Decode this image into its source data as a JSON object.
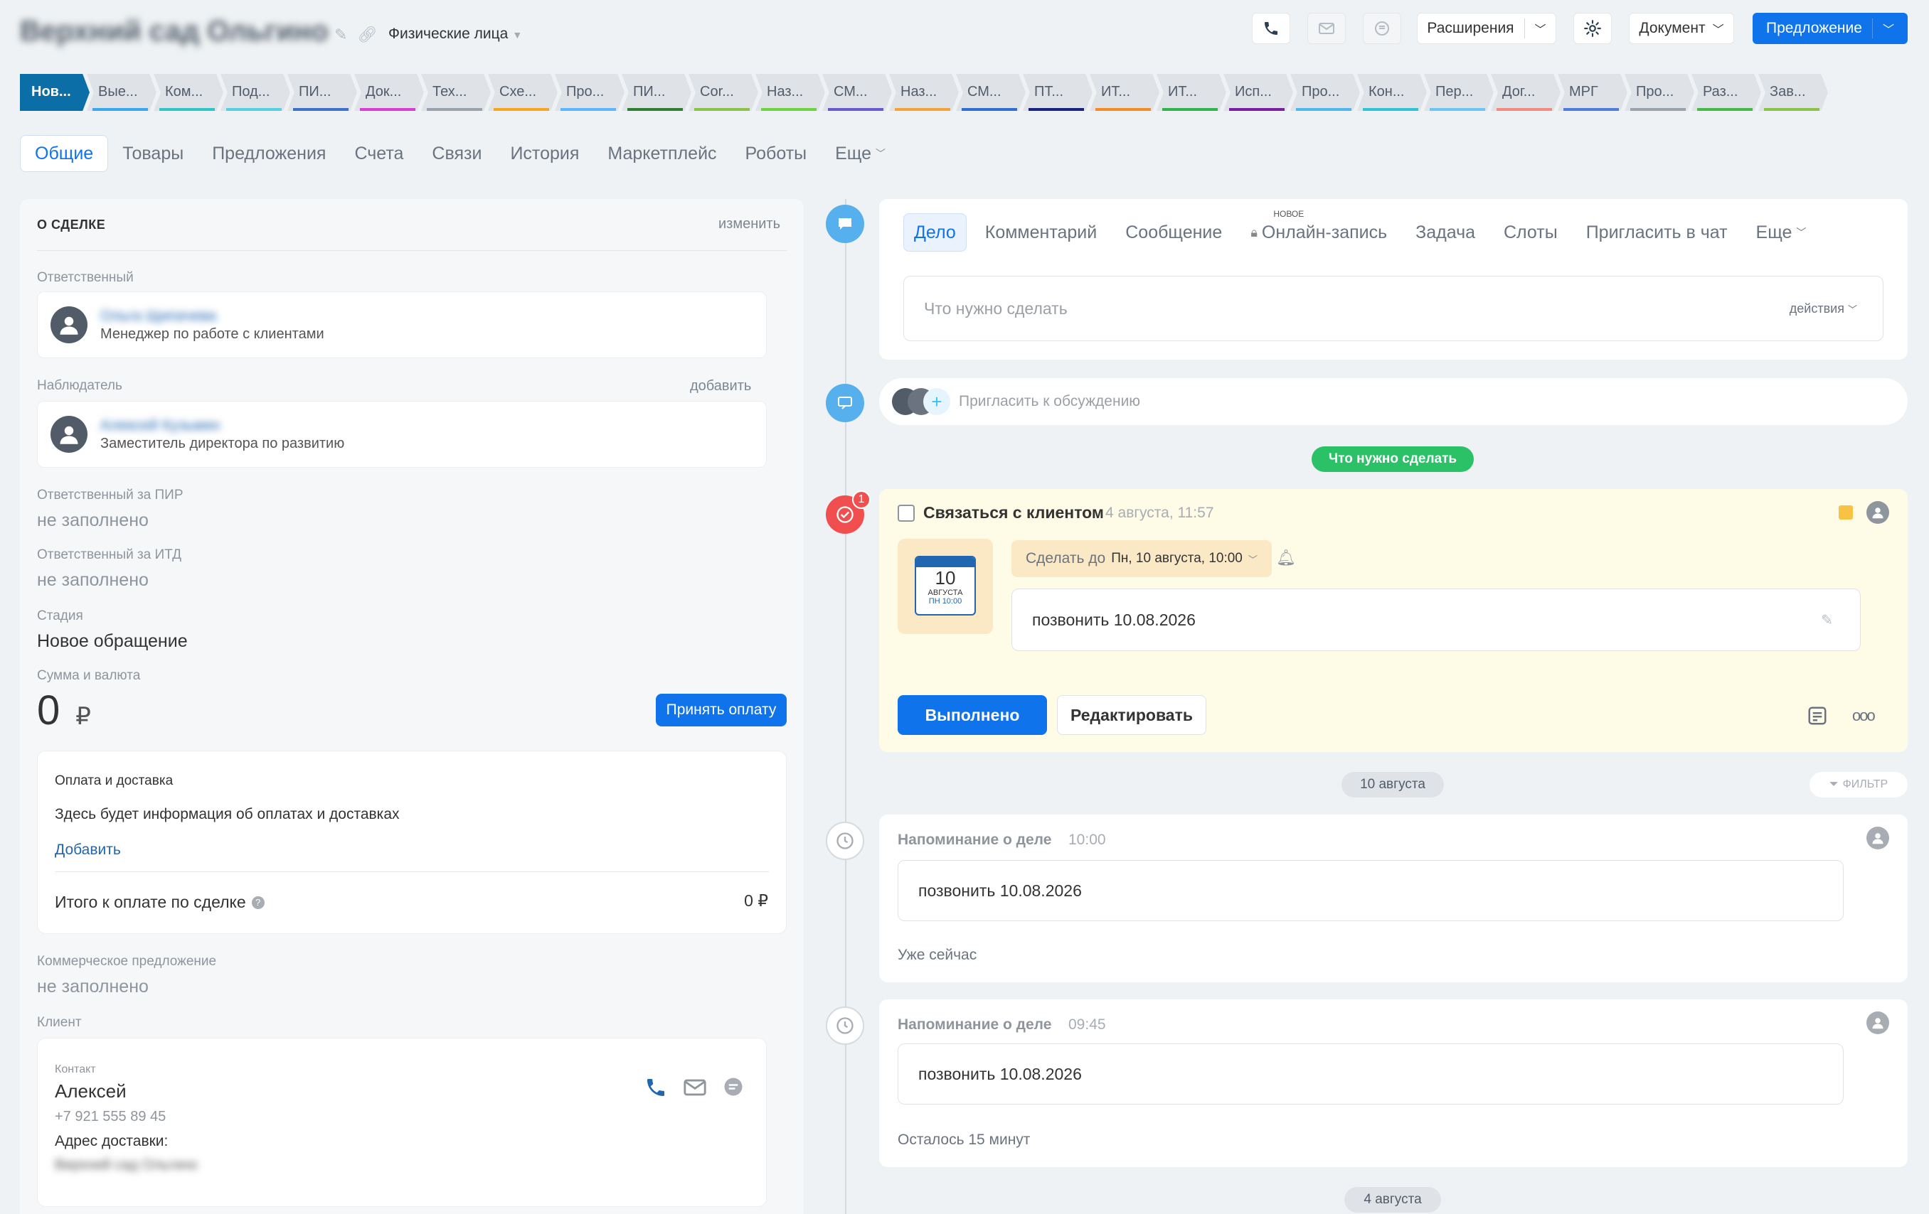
{
  "header": {
    "title": "Верхний сад Ольгино",
    "category": "Физические лица",
    "extensions_label": "Расширения",
    "document_label": "Документ",
    "offer_label": "Предложение"
  },
  "stages": [
    {
      "label": "Нов...",
      "color": "#0b6ea6",
      "active": true
    },
    {
      "label": "Вые...",
      "color": "#39a8ef"
    },
    {
      "label": "Ком...",
      "color": "#2fc6c6"
    },
    {
      "label": "Под...",
      "color": "#55d0e0"
    },
    {
      "label": "ПИ...",
      "color": "#3b71c9"
    },
    {
      "label": "Док...",
      "color": "#d63fd0"
    },
    {
      "label": "Тех...",
      "color": "#9aa3ad"
    },
    {
      "label": "Схе...",
      "color": "#f6a721"
    },
    {
      "label": "Про...",
      "color": "#5cb6ff"
    },
    {
      "label": "ПИ...",
      "color": "#2e7d32"
    },
    {
      "label": "Cor...",
      "color": "#8bc34a"
    },
    {
      "label": "Наз...",
      "color": "#6fd33f"
    },
    {
      "label": "СМ...",
      "color": "#6a5acd"
    },
    {
      "label": "Наз...",
      "color": "#f2a33a"
    },
    {
      "label": "СМ...",
      "color": "#2f6fd1"
    },
    {
      "label": "ПТ...",
      "color": "#1a237e"
    },
    {
      "label": "ИТ...",
      "color": "#f28c28"
    },
    {
      "label": "ИТ...",
      "color": "#33b34d"
    },
    {
      "label": "Исп...",
      "color": "#7b1fa2"
    },
    {
      "label": "Про...",
      "color": "#4fb7f0"
    },
    {
      "label": "Кон...",
      "color": "#2ec4d6"
    },
    {
      "label": "Пер...",
      "color": "#6ec4f2"
    },
    {
      "label": "Дог...",
      "color": "#f28b82"
    },
    {
      "label": "МРГ",
      "color": "#4f7cdb"
    },
    {
      "label": "Про...",
      "color": "#9aa3ad"
    },
    {
      "label": "Раз...",
      "color": "#48b848"
    },
    {
      "label": "Зав...",
      "color": "#8bc34a"
    }
  ],
  "tabs": [
    "Общие",
    "Товары",
    "Предложения",
    "Счета",
    "Связи",
    "История",
    "Маркетплейс",
    "Роботы",
    "Еще"
  ],
  "about": {
    "title": "О СДЕЛКЕ",
    "edit": "изменить",
    "responsible_label": "Ответственный",
    "responsible_name": "Ольга Щипачева",
    "responsible_role": "Менеджер по работе с клиентами",
    "observer_label": "Наблюдатель",
    "observer_add": "добавить",
    "observer_name": "Алексей Кузьмин",
    "observer_role": "Заместитель директора по развитию",
    "pir_label": "Ответственный за ПИР",
    "pir_value": "не заполнено",
    "itd_label": "Ответственный за ИТД",
    "itd_value": "не заполнено",
    "stage_label": "Стадия",
    "stage_value": "Новое обращение",
    "sum_label": "Сумма и валюта",
    "sum_value": "0",
    "currency": "₽",
    "accept_payment": "Принять оплату",
    "payment_title": "Оплата и доставка",
    "payment_text": "Здесь будет информация об оплатах и доставках",
    "payment_add": "Добавить",
    "total_label": "Итого к оплате по сделке",
    "total_value": "0 ₽",
    "commercial_label": "Коммерческое предложение",
    "commercial_value": "не заполнено",
    "client_label": "Клиент",
    "contact_label": "Контакт",
    "contact_name": "Алексей",
    "contact_phone": "+7 921 555 89 45",
    "delivery_label": "Адрес доставки:",
    "delivery_value": "Верхний сад Ольгино"
  },
  "timeline": {
    "tabs": [
      "Дело",
      "Комментарий",
      "Сообщение",
      "Онлайн-запись",
      "Задача",
      "Слоты",
      "Пригласить в чат",
      "Еще"
    ],
    "new_badge": "новое",
    "input_placeholder": "Что нужно сделать",
    "actions_label": "действия",
    "invite_placeholder": "Пригласить к обсуждению",
    "todo_pill": "Что нужно сделать",
    "task": {
      "badge": "1",
      "title": "Связаться с клиентом",
      "time": "4 августа, 11:57",
      "cal_day": "10",
      "cal_month": "АВГУСТА",
      "cal_time": "ПН 10:00",
      "deadline_label": "Сделать до",
      "deadline_value": "Пн, 10 августа, 10:00",
      "note": "позвонить 10.08.2026",
      "done_button": "Выполнено",
      "edit_button": "Редактировать"
    },
    "date_pill_1": "10 августа",
    "filter_label": "ФИЛЬТР",
    "reminders": [
      {
        "title": "Напоминание о деле",
        "time": "10:00",
        "text": "позвонить 10.08.2026",
        "status": "Уже сейчас"
      },
      {
        "title": "Напоминание о деле",
        "time": "09:45",
        "text": "позвонить 10.08.2026",
        "status": "Осталось 15 минут"
      }
    ],
    "date_pill_2": "4 августа"
  }
}
